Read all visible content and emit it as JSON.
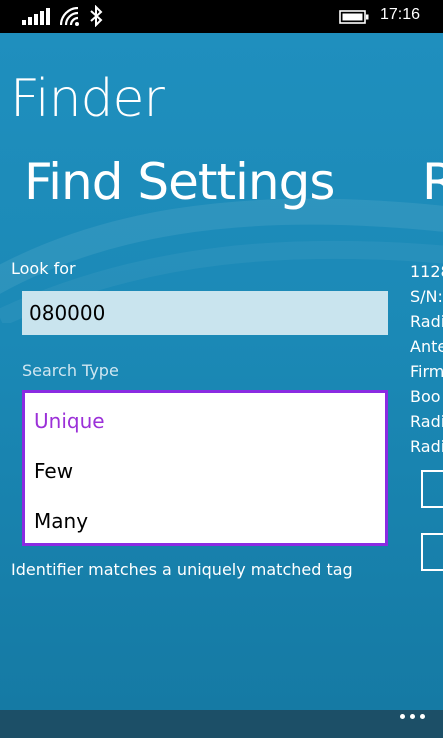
{
  "status_bar": {
    "time": "17:16",
    "icons": [
      "signal-icon",
      "wifi-icon",
      "bluetooth-icon",
      "battery-icon"
    ]
  },
  "app": {
    "title": "Finder"
  },
  "pivot": {
    "current_header": "Find Settings",
    "next_header_partial": "R"
  },
  "find_settings": {
    "look_for_label": "Look for",
    "look_for_value": "080000",
    "search_type_label": "Search Type",
    "search_type_options": [
      "Unique",
      "Few",
      "Many"
    ],
    "selected_option": "Unique",
    "description": "Identifier matches a uniquely matched tag"
  },
  "next_panel_peek": {
    "lines": [
      "1128",
      "S/N:",
      "Radi",
      "Ante",
      "Firm",
      "Boo",
      "Radi",
      "Radi"
    ]
  },
  "colors": {
    "background": "#1b89b6",
    "input_background": "#c9e4ee",
    "selection_accent": "#9b30d8",
    "app_bar": "#1c4f67"
  },
  "app_bar": {
    "more_icon": "ellipsis-icon"
  }
}
